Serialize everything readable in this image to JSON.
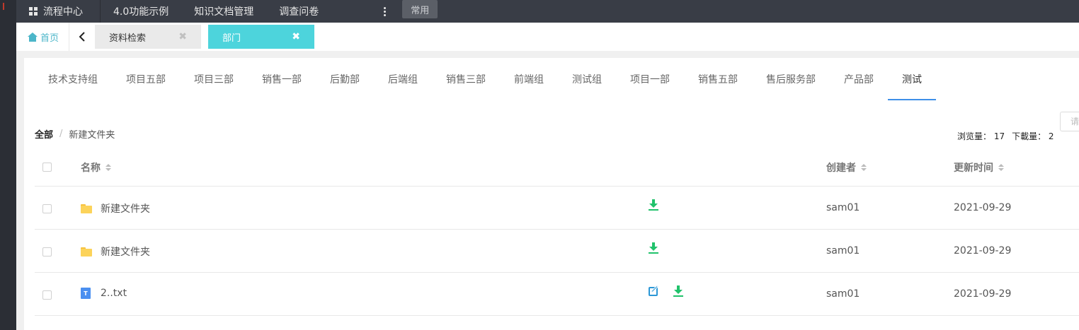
{
  "topnav": {
    "items": [
      "流程中心",
      "4.0功能示例",
      "知识文档管理",
      "调查问卷"
    ],
    "common_label": "常用"
  },
  "tabbar": {
    "home_label": "首页",
    "tabs": [
      {
        "label": "资料检索",
        "active": false
      },
      {
        "label": "部门",
        "active": true
      }
    ]
  },
  "dept_tabs": {
    "items": [
      "技术支持组",
      "项目五部",
      "项目三部",
      "销售一部",
      "后勤部",
      "后端组",
      "销售三部",
      "前端组",
      "测试组",
      "项目一部",
      "销售五部",
      "售后服务部",
      "产品部",
      "测试"
    ],
    "active_index": 13
  },
  "search": {
    "placeholder": "请"
  },
  "breadcrumb": {
    "root": "全部",
    "separator": "/",
    "current": "新建文件夹"
  },
  "stats": {
    "views": "浏览量： 17",
    "downloads": "下載量： 2"
  },
  "table": {
    "headers": {
      "name": "名称",
      "creator": "创建者",
      "updated": "更新时间"
    },
    "rows": [
      {
        "type": "folder",
        "name": "新建文件夹",
        "creator": "sam01",
        "updated": "2021-09-29",
        "editable": false
      },
      {
        "type": "folder",
        "name": "新建文件夹",
        "creator": "sam01",
        "updated": "2021-09-29",
        "editable": false
      },
      {
        "type": "file",
        "name": "2..txt",
        "creator": "sam01",
        "updated": "2021-09-29",
        "editable": true
      }
    ]
  },
  "icons": {
    "file_glyph": "T"
  },
  "colors": {
    "accent": "#4dd4dc",
    "download": "#21c26b",
    "edit": "#2b97d6",
    "active_underline": "#3d8fe8"
  }
}
